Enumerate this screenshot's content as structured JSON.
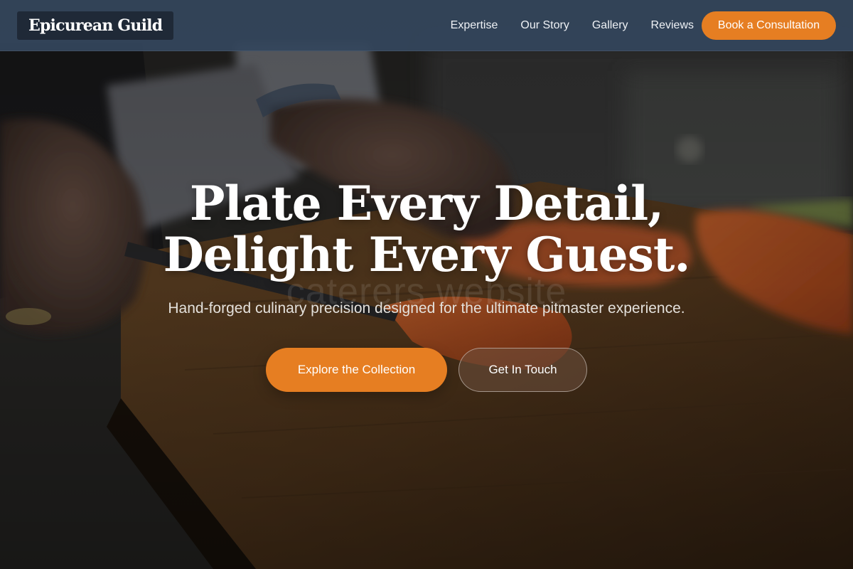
{
  "brand": {
    "logo_text": "Epicurean Guild"
  },
  "nav": {
    "links": [
      {
        "label": "Expertise"
      },
      {
        "label": "Our Story"
      },
      {
        "label": "Gallery"
      },
      {
        "label": "Reviews"
      }
    ],
    "cta_label": "Book a Consultation"
  },
  "hero": {
    "title_line1": "Plate Every Detail,",
    "title_line2": "Delight Every Guest.",
    "subtitle": "Hand-forged culinary precision designed for the ultimate pitmaster experience.",
    "watermark": "caterers website",
    "primary_button": "Explore the Collection",
    "secondary_button": "Get In Touch",
    "background_image": "chef slicing salmon on a wooden cutting board"
  },
  "colors": {
    "accent": "#e67e22",
    "nav_background": "#34465c",
    "logo_background": "#1f2937",
    "text_light": "#ffffff"
  }
}
